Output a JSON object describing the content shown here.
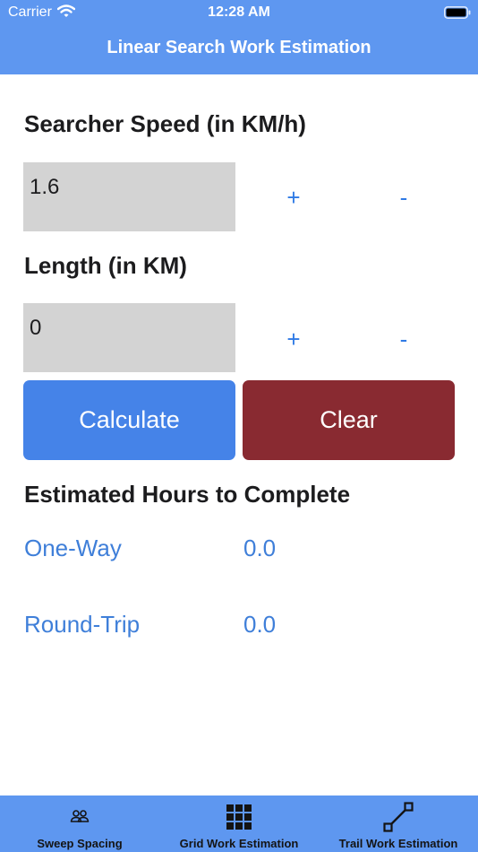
{
  "status_bar": {
    "carrier": "Carrier",
    "time": "12:28 AM"
  },
  "nav": {
    "title": "Linear Search Work Estimation"
  },
  "form": {
    "speed": {
      "label": "Searcher Speed (in KM/h)",
      "value": "1.6",
      "plus": "+",
      "minus": "-"
    },
    "length": {
      "label": "Length (in KM)",
      "value": "0",
      "plus": "+",
      "minus": "-"
    },
    "calculate_label": "Calculate",
    "clear_label": "Clear"
  },
  "results": {
    "title": "Estimated Hours to Complete",
    "one_way": {
      "label": "One-Way",
      "value": "0.0"
    },
    "round_trip": {
      "label": "Round-Trip",
      "value": "0.0"
    }
  },
  "tabs": [
    {
      "label": "Sweep Spacing",
      "icon": "people-icon"
    },
    {
      "label": "Grid Work Estimation",
      "icon": "grid-icon"
    },
    {
      "label": "Trail Work Estimation",
      "icon": "line-icon"
    }
  ],
  "colors": {
    "header": "#5e97f0",
    "calculate": "#4583e8",
    "clear": "#892a31",
    "accent": "#3f7fd9"
  }
}
